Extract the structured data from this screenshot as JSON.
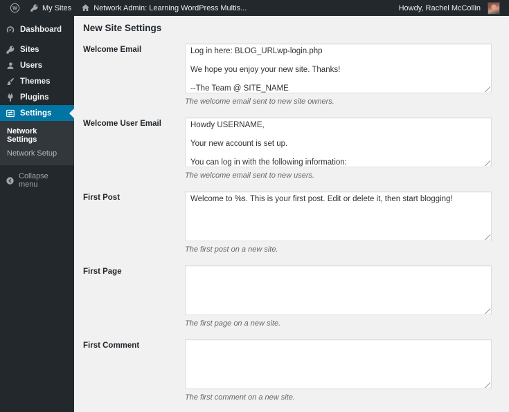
{
  "admin_bar": {
    "my_sites_label": "My Sites",
    "site_label": "Network Admin: Learning WordPress Multis...",
    "howdy_label": "Howdy, Rachel McCollin",
    "icons": [
      "wordpress-logo-icon",
      "network-key-icon",
      "home-icon"
    ]
  },
  "sidebar": {
    "items": [
      {
        "label": "Dashboard",
        "icon": "dashboard-gauge-icon",
        "active": false
      },
      {
        "label": "Sites",
        "icon": "sites-key-icon",
        "active": false
      },
      {
        "label": "Users",
        "icon": "users-icon",
        "active": false
      },
      {
        "label": "Themes",
        "icon": "themes-brush-icon",
        "active": false
      },
      {
        "label": "Plugins",
        "icon": "plugins-plug-icon",
        "active": false
      },
      {
        "label": "Settings",
        "icon": "settings-sliders-icon",
        "active": true
      }
    ],
    "submenu": [
      {
        "label": "Network Settings",
        "current": true
      },
      {
        "label": "Network Setup",
        "current": false
      }
    ],
    "collapse_label": "Collapse menu",
    "collapse_icon": "collapse-arrow-icon"
  },
  "page": {
    "title": "New Site Settings",
    "fields": [
      {
        "label": "Welcome Email",
        "value": "Log in here: BLOG_URLwp-login.php\n\nWe hope you enjoy your new site. Thanks!\n\n--The Team @ SITE_NAME",
        "help": "The welcome email sent to new site owners."
      },
      {
        "label": "Welcome User Email",
        "value": "Howdy USERNAME,\n\nYour new account is set up.\n\nYou can log in with the following information:",
        "help": "The welcome email sent to new users."
      },
      {
        "label": "First Post",
        "value": "Welcome to %s. This is your first post. Edit or delete it, then start blogging!",
        "help": "The first post on a new site."
      },
      {
        "label": "First Page",
        "value": "",
        "help": "The first page on a new site."
      },
      {
        "label": "First Comment",
        "value": "",
        "help": "The first comment on a new site."
      }
    ]
  },
  "colors": {
    "admin_bar_bg": "#23282d",
    "menu_bg": "#23282d",
    "submenu_bg": "#32373c",
    "active_item_bg": "#0074a2",
    "content_bg": "#f1f1f1",
    "textarea_border": "#dddddd",
    "help_text": "#666666",
    "heading_text": "#23282d"
  }
}
